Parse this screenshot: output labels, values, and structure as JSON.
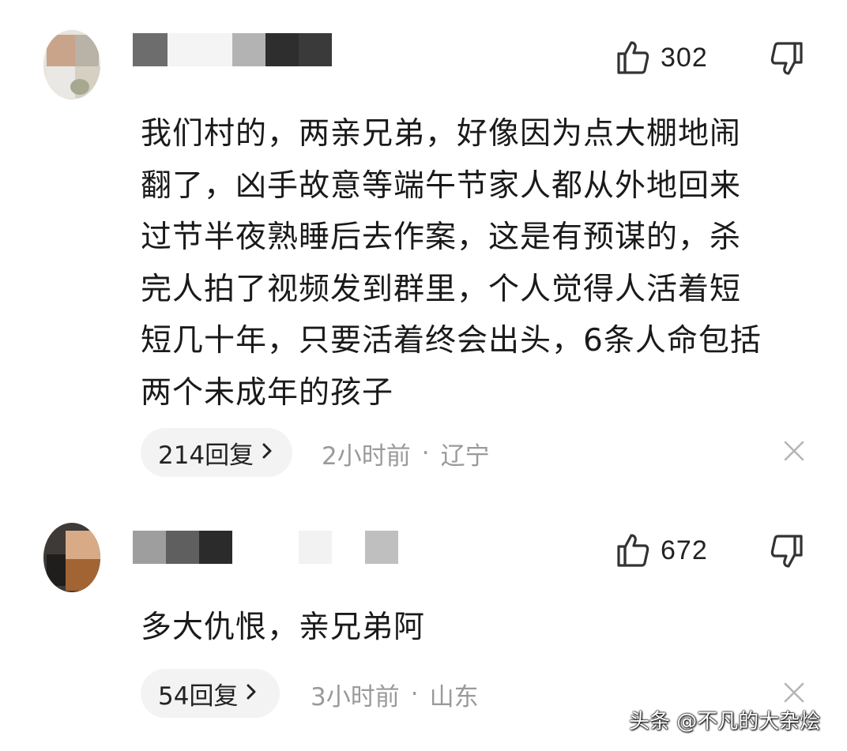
{
  "comments": [
    {
      "likes": "302",
      "text": "我们村的，两亲兄弟，好像因为点大棚地闹\n翻了，凶手故意等端午节家人都从外地回来\n过节半夜熟睡后去作案，这是有预谋的，杀\n完人拍了视频发到群里，个人觉得人活着短\n短几十年，只要活着终会出头，6条人命包括\n两个未成年的孩子",
      "replies": "214回复",
      "time": "2小时前",
      "separator": "·",
      "location": "辽宁"
    },
    {
      "likes": "672",
      "text": "多大仇恨，亲兄弟阿",
      "replies": "54回复",
      "time": "3小时前",
      "separator": "·",
      "location": "山东"
    }
  ],
  "icons": {
    "like": "thumbs-up-icon",
    "dislike": "thumbs-down-icon",
    "reply_more": "chevron-right-icon",
    "close": "close-icon"
  },
  "watermark": "头条 @不凡的大杂烩",
  "colors": {
    "text": "#1a1a1a",
    "meta": "#9a9a9a",
    "pill_bg": "#f3f3f3",
    "icon": "#333333"
  }
}
